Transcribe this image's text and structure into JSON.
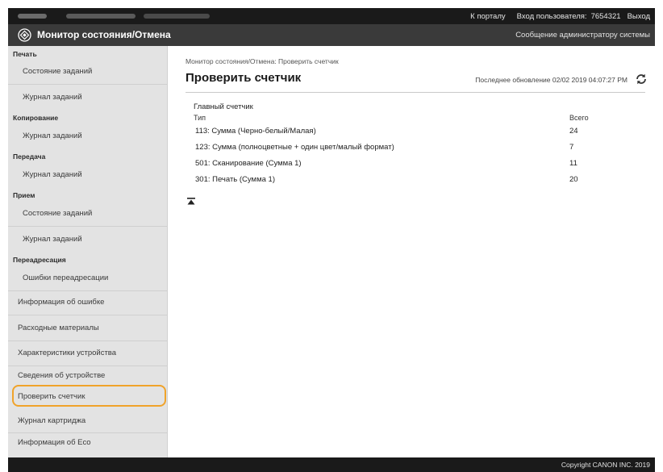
{
  "topbar": {
    "portal_link": "К порталу",
    "login_label": "Вход пользователя:",
    "user_id": "7654321",
    "logout_link": "Выход"
  },
  "header": {
    "app_title": "Монитор состояния/Отмена",
    "admin_message_link": "Сообщение администратору системы"
  },
  "sidebar": {
    "sections": [
      {
        "title": "Печать",
        "items": [
          "Состояние заданий",
          "Журнал заданий"
        ]
      },
      {
        "title": "Копирование",
        "items": [
          "Журнал заданий"
        ]
      },
      {
        "title": "Передача",
        "items": [
          "Журнал заданий"
        ]
      },
      {
        "title": "Прием",
        "items": [
          "Состояние заданий",
          "Журнал заданий"
        ]
      },
      {
        "title": "Переадресация",
        "items": [
          "Ошибки переадресации"
        ]
      }
    ],
    "extra_items": [
      "Информация об ошибке",
      "Расходные материалы",
      "Характеристики устройства",
      "Сведения об устройстве",
      "Проверить счетчик",
      "Журнал картриджа",
      "Информация об Eco"
    ],
    "selected_item": "Проверить счетчик",
    "highlight_color": "#f0a32a"
  },
  "main": {
    "breadcrumb": "Монитор состояния/Отмена: Проверить счетчик",
    "title": "Проверить счетчик",
    "last_update": "Последнее обновление 02/02 2019 04:07:27 PM",
    "counter_section_title": "Главный счетчик",
    "columns": [
      "Тип",
      "Всего"
    ],
    "rows": [
      {
        "type": "113: Сумма (Черно-белый/Малая)",
        "total": "24"
      },
      {
        "type": "123: Сумма (полноцветные + один цвет/малый формат)",
        "total": "7"
      },
      {
        "type": "501: Сканирование (Сумма 1)",
        "total": "11"
      },
      {
        "type": "301: Печать (Сумма 1)",
        "total": "20"
      }
    ]
  },
  "footer": {
    "copyright": "Copyright CANON INC. 2019"
  },
  "colors": {
    "topbar": "#1a1a1a",
    "titlebar": "#3a3a3a",
    "sidebar": "#e3e3e3",
    "accent": "#f0a32a"
  }
}
